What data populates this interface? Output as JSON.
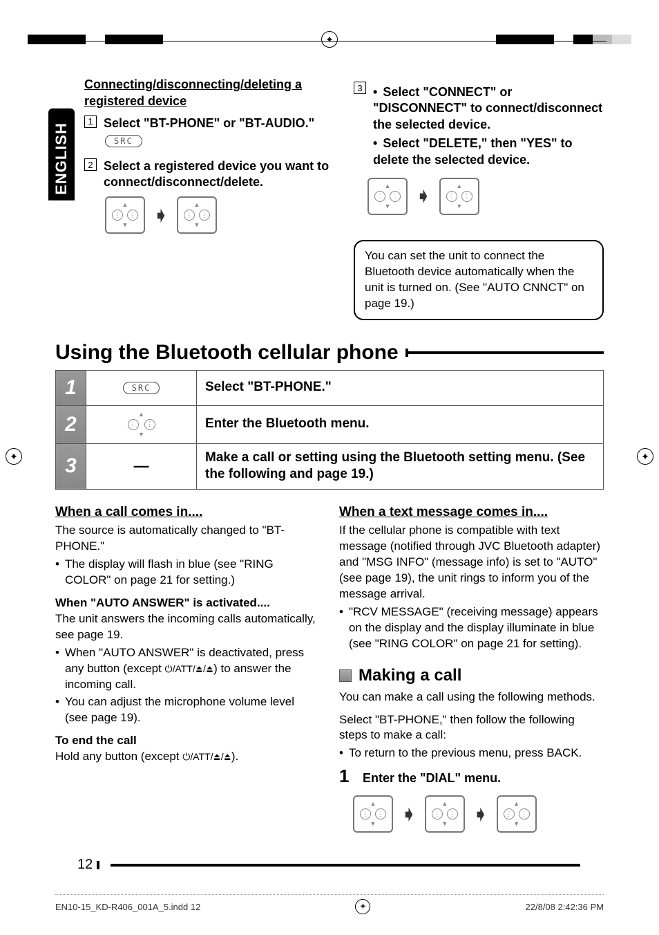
{
  "language_tab": "ENGLISH",
  "top_left": {
    "heading": "Connecting/disconnecting/deleting a registered device",
    "steps": [
      {
        "num": "1",
        "text": "Select \"BT-PHONE\" or \"BT-AUDIO.\""
      },
      {
        "num": "2",
        "text": "Select a registered device you want to connect/disconnect/delete."
      }
    ],
    "src_label": "SRC"
  },
  "top_right": {
    "step_num": "3",
    "bullets": [
      "Select \"CONNECT\" or \"DISCONNECT\" to connect/disconnect the selected device.",
      "Select \"DELETE,\" then \"YES\" to delete the selected device."
    ],
    "tip": "You can set the unit to connect the Bluetooth device automatically when the unit is turned on. (See \"AUTO CNNCT\" on page 19.)"
  },
  "main_heading": "Using the Bluetooth cellular phone",
  "table": {
    "rows": [
      {
        "num": "1",
        "ctrl": "SRC",
        "desc": "Select \"BT-PHONE.\""
      },
      {
        "num": "2",
        "ctrl": "nav",
        "desc": "Enter the Bluetooth menu."
      },
      {
        "num": "3",
        "ctrl": "—",
        "desc": "Make a call or setting using the Bluetooth setting menu. (See the following and page 19.)"
      }
    ]
  },
  "left_body": {
    "h1": "When a call comes in....",
    "p1": "The source is automatically changed to \"BT-PHONE.\"",
    "b1": "The display will flash in blue (see \"RING COLOR\" on page 21 for setting.)",
    "h2": "When \"AUTO ANSWER\" is activated....",
    "p2": "The unit answers the incoming calls automatically, see page 19.",
    "b2a": "When \"AUTO ANSWER\" is deactivated, press any button (except ",
    "b2a_icons": "⏻/ATT/⏏/⏏",
    "b2a_tail": ") to answer the incoming call.",
    "b2b": "You can adjust the microphone volume level (see page 19).",
    "h3": "To end the call",
    "p3_lead": "Hold any button (except ",
    "p3_icons": "⏻/ATT/⏏/⏏",
    "p3_tail": ")."
  },
  "right_body": {
    "h1": "When a text message comes in....",
    "p1": "If the cellular phone is compatible with text message (notified through JVC Bluetooth adapter) and \"MSG INFO\" (message info) is set to \"AUTO\" (see page 19), the unit rings to inform you of the message arrival.",
    "b1": "\"RCV MESSAGE\" (receiving message) appears on the display and the display illuminate in blue (see \"RING COLOR\" on page 21 for setting).",
    "h2": "Making a call",
    "p2": "You can make a call using the following methods.",
    "p3": "Select \"BT-PHONE,\" then follow the following steps to make a call:",
    "b2": "To return to the previous menu, press BACK.",
    "step1_num": "1",
    "step1_text": "Enter the \"DIAL\" menu."
  },
  "page_number": "12",
  "footer": {
    "file": "EN10-15_KD-R406_001A_5.indd   12",
    "date": "22/8/08   2:42:36 PM"
  }
}
